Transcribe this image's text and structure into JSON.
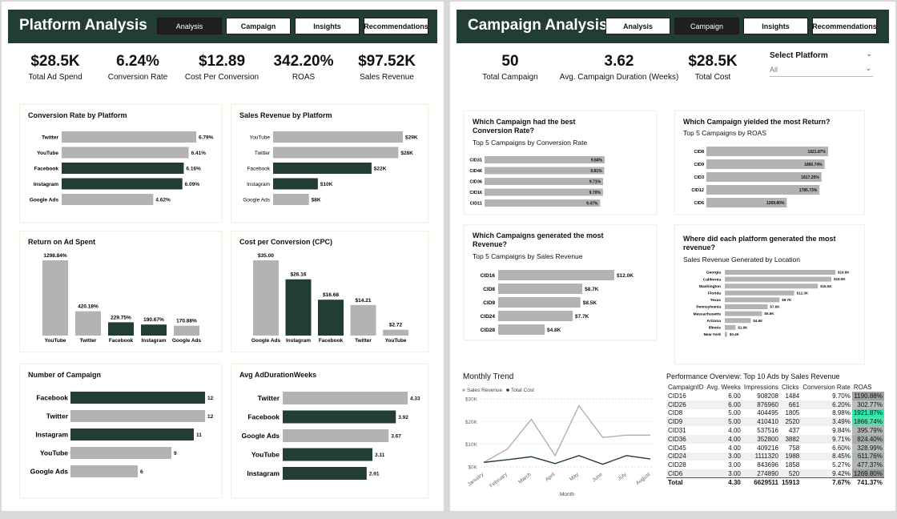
{
  "left": {
    "title": "Platform Analysis",
    "nav": [
      "Analysis",
      "Campaign",
      "Insights",
      "Recommendations"
    ],
    "active_nav": "Analysis",
    "kpis": [
      {
        "value": "$28.5K",
        "label": "Total Ad Spend"
      },
      {
        "value": "6.24%",
        "label": "Conversion Rate"
      },
      {
        "value": "$12.89",
        "label": "Cost Per Conversion"
      },
      {
        "value": "342.20%",
        "label": "ROAS"
      },
      {
        "value": "$97.52K",
        "label": "Sales Revenue"
      }
    ],
    "cards": {
      "conv": "Conversion Rate by Platform",
      "sales": "Sales Revenue by Platform",
      "roas": "Return on Ad Spent",
      "cpc": "Cost per Conversion (CPC)",
      "num": "Number of Campaign",
      "dur": "Avg AdDurationWeeks"
    }
  },
  "right": {
    "title": "Campaign Analysis",
    "nav": [
      "Analysis",
      "Campaign",
      "Insights",
      "Recommendations"
    ],
    "active_nav": "Campaign",
    "kpis": [
      {
        "value": "50",
        "label": "Total Campaign"
      },
      {
        "value": "3.62",
        "label": "Avg. Campaign Duration (Weeks)"
      },
      {
        "value": "$28.5K",
        "label": "Total Cost"
      }
    ],
    "filter": {
      "title": "Select Platform",
      "value": "All"
    },
    "cards": {
      "best_conv_title": "Which Campaign had the best Conversion Rate?",
      "best_conv_sub": "Top 5 Campaigns by Conversion Rate",
      "most_return_title": "Which Campaign yielded the most Return?",
      "most_return_sub": "Top 5 Campaigns by ROAS",
      "most_rev_title": "Which Campaigns generated the most Revenue?",
      "most_rev_sub": "Top 5 Campaigns by Sales Revenue",
      "location_title": "Where did each platform generated the most revenue?",
      "location_sub": "Sales Revenue Generated by Location",
      "trend_title": "Monthly Trend",
      "perf_title": "Performance Overview: Top 10 Ads by Sales Revenue"
    }
  },
  "table": {
    "headers": [
      "CampaignID",
      "Avg. Weeks",
      "Impressions",
      "Clicks",
      "Conversion Rate",
      "ROAS"
    ],
    "rows": [
      [
        "CID16",
        "6.00",
        "908208",
        "1484",
        "9.70%",
        "1190.88%"
      ],
      [
        "CID26",
        "6.00",
        "876960",
        "661",
        "6.20%",
        "302.77%"
      ],
      [
        "CID8",
        "5.00",
        "404495",
        "1805",
        "8.98%",
        "1921.87%"
      ],
      [
        "CID9",
        "5.00",
        "410410",
        "2520",
        "3.49%",
        "1866.74%"
      ],
      [
        "CID31",
        "4.00",
        "537516",
        "437",
        "9.84%",
        "395.79%"
      ],
      [
        "CID36",
        "4.00",
        "352800",
        "3882",
        "9.71%",
        "824.40%"
      ],
      [
        "CID45",
        "4.00",
        "409216",
        "758",
        "6.60%",
        "328.99%"
      ],
      [
        "CID24",
        "3.00",
        "1111320",
        "1988",
        "8.45%",
        "611.76%"
      ],
      [
        "CID28",
        "3.00",
        "843696",
        "1858",
        "5.27%",
        "477.37%"
      ],
      [
        "CID6",
        "3.00",
        "274890",
        "520",
        "9.42%",
        "1269.80%"
      ]
    ],
    "total": [
      "Total",
      "4.30",
      "6629511",
      "15913",
      "7.67%",
      "741.37%"
    ],
    "roas_colors": [
      "#9da39f",
      "#b9beba",
      "#2ee8b0",
      "#5fdcae",
      "#b3b8b4",
      "#a7ada9",
      "#b9beba",
      "#acb2ae",
      "#b3b8b4",
      "#98a09b"
    ]
  },
  "chart_data": [
    {
      "type": "bar",
      "orientation": "horizontal",
      "title": "Conversion Rate by Platform",
      "categories": [
        "Twitter",
        "YouTube",
        "Facebook",
        "Instagram",
        "Google Ads"
      ],
      "values": [
        6.79,
        6.41,
        6.16,
        6.09,
        4.62
      ],
      "labels": [
        "6.79%",
        "6.41%",
        "6.16%",
        "6.09%",
        "4.62%"
      ],
      "colors": [
        "#b3b3b3",
        "#b3b3b3",
        "#223d33",
        "#223d33",
        "#b3b3b3"
      ]
    },
    {
      "type": "bar",
      "orientation": "horizontal",
      "title": "Sales Revenue by Platform",
      "categories": [
        "YouTube",
        "Twitter",
        "Facebook",
        "Instagram",
        "Google Ads"
      ],
      "values": [
        29,
        28,
        22,
        10,
        8
      ],
      "labels": [
        "$29K",
        "$28K",
        "$22K",
        "$10K",
        "$8K"
      ],
      "colors": [
        "#b3b3b3",
        "#b3b3b3",
        "#223d33",
        "#223d33",
        "#b3b3b3"
      ]
    },
    {
      "type": "bar",
      "orientation": "vertical",
      "title": "Return on Ad Spent",
      "categories": [
        "YouTube",
        "Twitter",
        "Facebook",
        "Instagram",
        "Google Ads"
      ],
      "values": [
        1298.84,
        420.18,
        229.75,
        190.67,
        170.88
      ],
      "labels": [
        "1298.84%",
        "420.18%",
        "229.75%",
        "190.67%",
        "170.88%"
      ],
      "colors": [
        "#b3b3b3",
        "#b3b3b3",
        "#223d33",
        "#223d33",
        "#b3b3b3"
      ]
    },
    {
      "type": "bar",
      "orientation": "vertical",
      "title": "Cost per Conversion (CPC)",
      "categories": [
        "Google Ads",
        "Instagram",
        "Facebook",
        "Twitter",
        "YouTube"
      ],
      "values": [
        35.0,
        26.16,
        16.68,
        14.21,
        2.72
      ],
      "labels": [
        "$35.00",
        "$26.16",
        "$16.68",
        "$14.21",
        "$2.72"
      ],
      "colors": [
        "#b3b3b3",
        "#223d33",
        "#223d33",
        "#b3b3b3",
        "#b3b3b3"
      ]
    },
    {
      "type": "bar",
      "orientation": "horizontal",
      "title": "Number of Campaign",
      "categories": [
        "Facebook",
        "Twitter",
        "Instagram",
        "YouTube",
        "Google Ads"
      ],
      "values": [
        12,
        12,
        11,
        9,
        6
      ],
      "labels": [
        "12",
        "12",
        "11",
        "9",
        "6"
      ],
      "colors": [
        "#223d33",
        "#b3b3b3",
        "#223d33",
        "#b3b3b3",
        "#b3b3b3"
      ]
    },
    {
      "type": "bar",
      "orientation": "horizontal",
      "title": "Avg AdDurationWeeks",
      "categories": [
        "Twitter",
        "Facebook",
        "Google Ads",
        "YouTube",
        "Instagram"
      ],
      "values": [
        4.33,
        3.92,
        3.67,
        3.11,
        2.91
      ],
      "labels": [
        "4.33",
        "3.92",
        "3.67",
        "3.11",
        "2.91"
      ],
      "colors": [
        "#b3b3b3",
        "#223d33",
        "#b3b3b3",
        "#223d33",
        "#223d33"
      ]
    },
    {
      "type": "bar",
      "orientation": "horizontal",
      "title": "Top 5 Campaigns by Conversion Rate",
      "categories": [
        "CID31",
        "CID46",
        "CID36",
        "CID16",
        "CID11"
      ],
      "values": [
        9.84,
        9.81,
        9.71,
        9.7,
        9.47
      ],
      "labels": [
        "9.84%",
        "9.81%",
        "9.71%",
        "9.70%",
        "9.47%"
      ],
      "colors": [
        "#b3b3b3",
        "#b3b3b3",
        "#b3b3b3",
        "#b3b3b3",
        "#b3b3b3"
      ]
    },
    {
      "type": "bar",
      "orientation": "horizontal",
      "title": "Top 5 Campaigns by ROAS",
      "categories": [
        "CID8",
        "CID9",
        "CID3",
        "CID12",
        "CID6"
      ],
      "values": [
        1921.87,
        1866.74,
        1817.25,
        1785.73,
        1269.8
      ],
      "labels": [
        "1921.87%",
        "1866.74%",
        "1817.25%",
        "1785.73%",
        "1269.80%"
      ],
      "colors": [
        "#b3b3b3",
        "#b3b3b3",
        "#b3b3b3",
        "#b3b3b3",
        "#b3b3b3"
      ]
    },
    {
      "type": "bar",
      "orientation": "horizontal",
      "title": "Top 5 Campaigns by Sales Revenue",
      "categories": [
        "CID16",
        "CID8",
        "CID9",
        "CID24",
        "CID28"
      ],
      "values": [
        12.0,
        8.7,
        8.5,
        7.7,
        4.8
      ],
      "labels": [
        "$12.0K",
        "$8.7K",
        "$8.5K",
        "$7.7K",
        "$4.8K"
      ],
      "colors": [
        "#b3b3b3",
        "#b3b3b3",
        "#b3b3b3",
        "#b3b3b3",
        "#b3b3b3"
      ]
    },
    {
      "type": "bar",
      "orientation": "horizontal",
      "title": "Sales Revenue Generated by Location",
      "categories": [
        "Georgia",
        "California",
        "Washington",
        "Florida",
        "Texas",
        "Pennsylvania",
        "Massachusetts",
        "Arizona",
        "Illinois",
        "New York"
      ],
      "values": [
        19.6,
        18.9,
        16.5,
        12.3,
        9.7,
        7.6,
        6.6,
        4.6,
        1.9,
        0.4
      ],
      "labels": [
        "$19.6K",
        "$18.9K",
        "$16.5K",
        "$12.3K",
        "$9.7K",
        "$7.6K",
        "$6.6K",
        "$4.6K",
        "$1.9K",
        "$0.4K"
      ],
      "colors": [
        "#b3b3b3",
        "#b3b3b3",
        "#b3b3b3",
        "#b3b3b3",
        "#b3b3b3",
        "#b3b3b3",
        "#b3b3b3",
        "#b3b3b3",
        "#b3b3b3",
        "#b3b3b3"
      ]
    },
    {
      "type": "line",
      "title": "Monthly Trend",
      "x": [
        "January",
        "February",
        "March",
        "April",
        "May",
        "June",
        "July",
        "August"
      ],
      "xlabel": "Month",
      "yticks": [
        "$0K",
        "$10K",
        "$20K",
        "$30K"
      ],
      "ylim": [
        0,
        30000
      ],
      "series": [
        {
          "name": "Sales Revenue",
          "color": "#b0b0b0",
          "values": [
            2000,
            8000,
            21000,
            5000,
            27000,
            13000,
            14000,
            14000
          ]
        },
        {
          "name": "Total Cost",
          "color": "#1f3a33",
          "values": [
            2000,
            3200,
            4500,
            1500,
            5000,
            1200,
            5000,
            3500
          ]
        }
      ]
    }
  ]
}
